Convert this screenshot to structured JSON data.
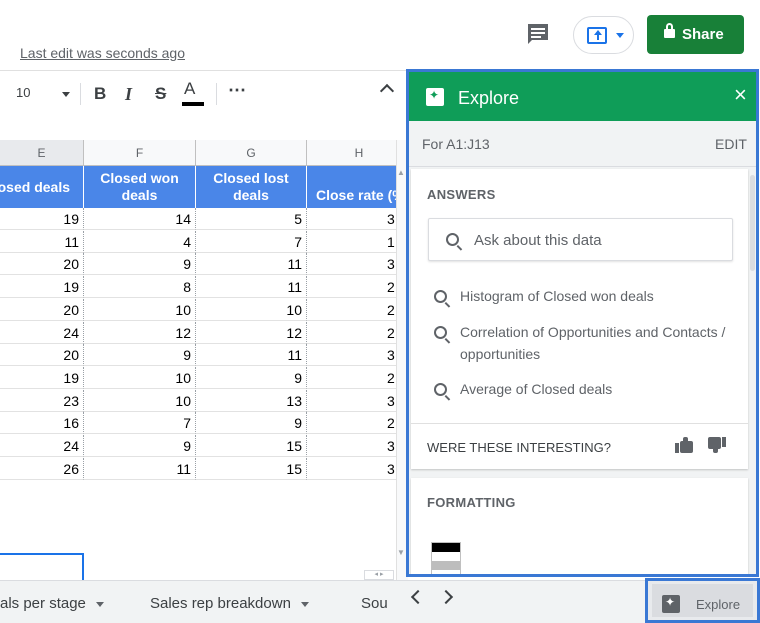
{
  "header": {
    "last_edit": "Last edit was seconds ago",
    "share_label": "Share",
    "comment_icon": "comment-icon",
    "present_icon": "present-to-meeting-icon"
  },
  "toolbar": {
    "font_size": "10",
    "bold": "B",
    "italic": "I",
    "strike": "S",
    "text_color": "A",
    "more": "⋯"
  },
  "grid": {
    "column_letters": [
      "E",
      "F",
      "G",
      "H"
    ],
    "headers": [
      "osed deals",
      "Closed won deals",
      "Closed lost deals",
      "Close rate (%"
    ],
    "rows": [
      [
        "19",
        "14",
        "5",
        "3"
      ],
      [
        "11",
        "4",
        "7",
        "1"
      ],
      [
        "20",
        "9",
        "11",
        "3"
      ],
      [
        "19",
        "8",
        "11",
        "2"
      ],
      [
        "20",
        "10",
        "10",
        "2"
      ],
      [
        "24",
        "12",
        "12",
        "2"
      ],
      [
        "20",
        "9",
        "11",
        "3"
      ],
      [
        "19",
        "10",
        "9",
        "2"
      ],
      [
        "23",
        "10",
        "13",
        "3"
      ],
      [
        "16",
        "7",
        "9",
        "2"
      ],
      [
        "24",
        "9",
        "15",
        "3"
      ],
      [
        "26",
        "11",
        "15",
        "3"
      ]
    ]
  },
  "tabs": {
    "items": [
      "als per stage",
      "Sales rep breakdown",
      "Sou"
    ]
  },
  "explore": {
    "title": "Explore",
    "close": "×",
    "range_label": "For A1:J13",
    "edit_label": "EDIT",
    "answers_title": "ANSWERS",
    "ask_placeholder": "Ask about this data",
    "suggestions": [
      "Histogram of Closed won deals",
      "Correlation of Opportunities and Contacts / opportunities",
      "Average of Closed deals"
    ],
    "interesting_label": "WERE THESE INTERESTING?",
    "formatting_title": "FORMATTING",
    "footer_label": "Explore"
  },
  "colors": {
    "share_green": "#188038",
    "explore_green": "#0f9d58",
    "header_blue": "#4a86e8",
    "highlight_blue": "#3a78d4"
  }
}
